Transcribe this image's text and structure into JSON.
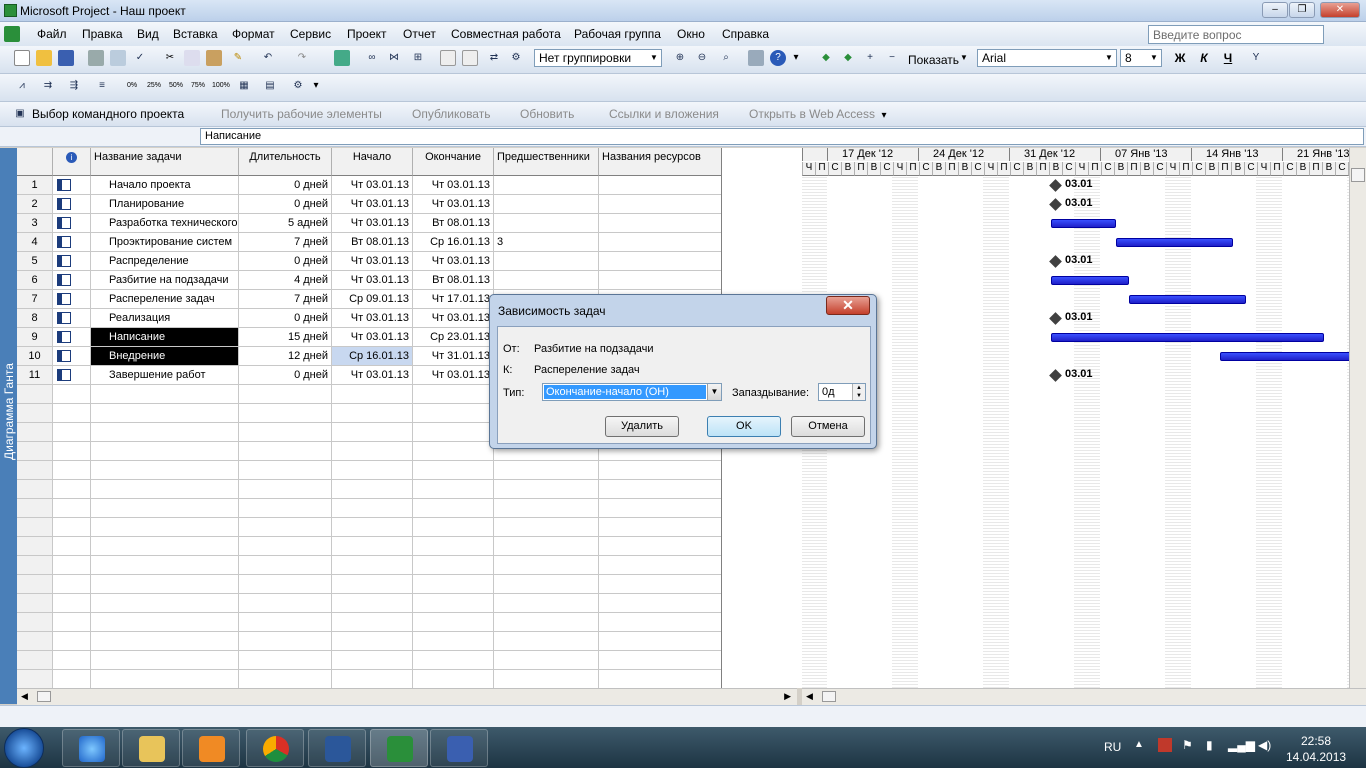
{
  "window": {
    "title": "Microsoft Project - Наш проект",
    "min": "–",
    "restore": "❐",
    "close": "✕"
  },
  "menu": {
    "items": [
      "Файл",
      "Правка",
      "Вид",
      "Вставка",
      "Формат",
      "Сервис",
      "Проект",
      "Отчет",
      "Совместная работа",
      "Рабочая группа",
      "Окно",
      "Справка"
    ],
    "ask": "Введите вопрос"
  },
  "toolbar1": {
    "grouping": "Нет группировки",
    "show": "Показать",
    "font": "Arial",
    "size": "8",
    "bold": "Ж",
    "italic": "К",
    "underline": "Ч"
  },
  "toolbar2": {
    "pct": [
      "0%",
      "25%",
      "50%",
      "75%",
      "100%"
    ]
  },
  "toolbar3": {
    "items": [
      "Выбор командного проекта",
      "Получить рабочие элементы",
      "Опубликовать",
      "Обновить",
      "Ссылки и вложения",
      "Открыть в Web Access"
    ]
  },
  "entry": {
    "value": "Написание"
  },
  "viewbar": {
    "label": "Диаграмма Ганта"
  },
  "table": {
    "columns": [
      "Название задачи",
      "Длительность",
      "Начало",
      "Окончание",
      "Предшественники",
      "Названия ресурсов"
    ],
    "rows": [
      {
        "id": "1",
        "name": "Начало проекта",
        "dur": "0 дней",
        "start": "Чт 03.01.13",
        "end": "Чт 03.01.13",
        "pred": ""
      },
      {
        "id": "2",
        "name": "Планирование",
        "dur": "0 дней",
        "start": "Чт 03.01.13",
        "end": "Чт 03.01.13",
        "pred": ""
      },
      {
        "id": "3",
        "name": "Разработка технического",
        "dur": "5 адней",
        "start": "Чт 03.01.13",
        "end": "Вт 08.01.13",
        "pred": ""
      },
      {
        "id": "4",
        "name": "Проэктирование систем",
        "dur": "7 дней",
        "start": "Вт 08.01.13",
        "end": "Ср 16.01.13",
        "pred": "3"
      },
      {
        "id": "5",
        "name": "Распределение",
        "dur": "0 дней",
        "start": "Чт 03.01.13",
        "end": "Чт 03.01.13",
        "pred": ""
      },
      {
        "id": "6",
        "name": "Разбитие на подзадачи",
        "dur": "4 дней",
        "start": "Чт 03.01.13",
        "end": "Вт 08.01.13",
        "pred": ""
      },
      {
        "id": "7",
        "name": "Распереление задач",
        "dur": "7 дней",
        "start": "Ср 09.01.13",
        "end": "Чт 17.01.13",
        "pred": ""
      },
      {
        "id": "8",
        "name": "Реализация",
        "dur": "0 дней",
        "start": "Чт 03.01.13",
        "end": "Чт 03.01.13",
        "pred": ""
      },
      {
        "id": "9",
        "name": "Написание",
        "dur": "15 дней",
        "start": "Чт 03.01.13",
        "end": "Ср 23.01.13",
        "pred": ""
      },
      {
        "id": "10",
        "name": "Внедрение",
        "dur": "12 дней",
        "start": "Ср 16.01.13",
        "end": "Чт 31.01.13",
        "pred": ""
      },
      {
        "id": "11",
        "name": "Завершение работ",
        "dur": "0 дней",
        "start": "Чт 03.01.13",
        "end": "Чт 03.01.13",
        "pred": ""
      }
    ]
  },
  "gantt": {
    "weeks": [
      "17 Дек '12",
      "24 Дек '12",
      "31 Дек '12",
      "07 Янв '13",
      "14 Янв '13",
      "21 Янв '13"
    ],
    "days": [
      "С",
      "В",
      "П",
      "В",
      "С",
      "Ч",
      "П"
    ],
    "milestone_label": "03.01"
  },
  "dialog": {
    "title": "Зависимость задач",
    "from_label": "От:",
    "from": "Разбитие на подзадачи",
    "to_label": "К:",
    "to": "Распереление задач",
    "type_label": "Тип:",
    "type": "Окончание-начало (ОН)",
    "lag_label": "Запаздывание:",
    "lag": "0д",
    "delete": "Удалить",
    "ok": "OK",
    "cancel": "Отмена"
  },
  "tray": {
    "lang": "RU",
    "time": "22:58",
    "date": "14.04.2013"
  }
}
